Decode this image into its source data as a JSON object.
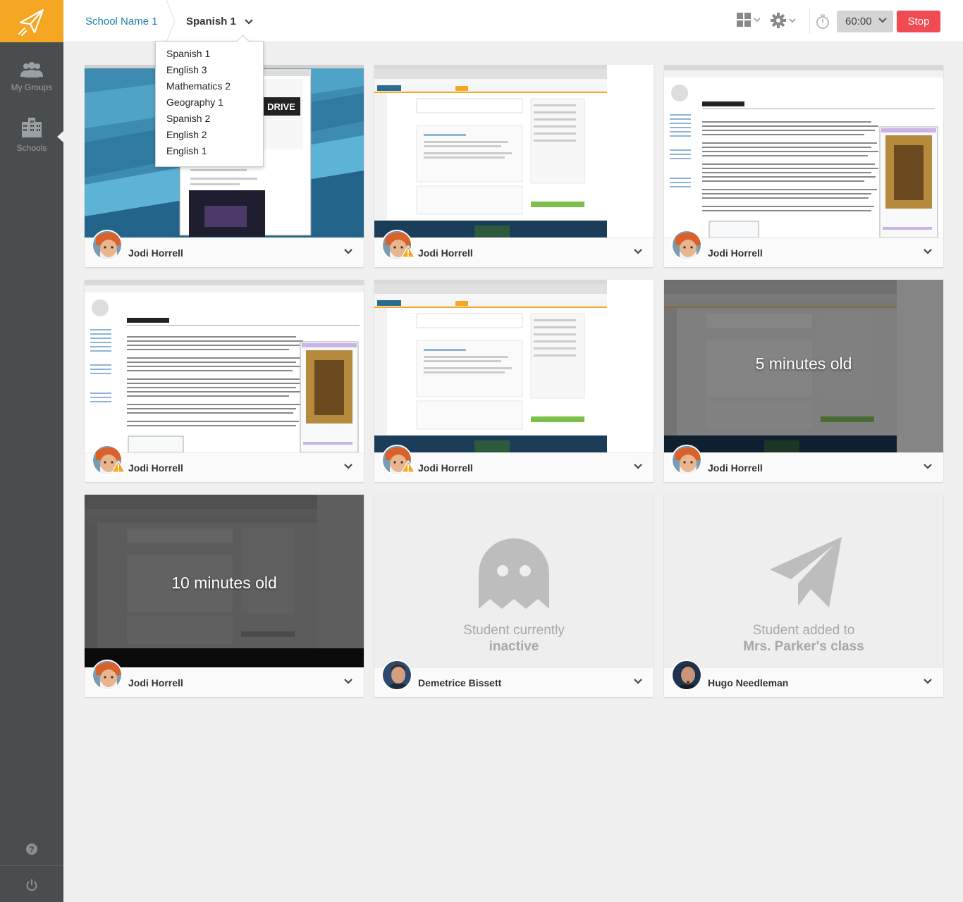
{
  "topbar": {
    "school": "School Name 1",
    "class_name": "Spanish 1",
    "timer": "60:00",
    "stop": "Stop"
  },
  "dropdown": {
    "items": [
      "Spanish 1",
      "English 3",
      "Mathematics 2",
      "Geography 1",
      "Spanish 2",
      "English 2",
      "English 1"
    ]
  },
  "sidebar": {
    "groups_label": "My Groups",
    "schools_label": "Schools"
  },
  "cards": [
    {
      "name": "Jodi Horrell",
      "screen": "desktop",
      "warning": false
    },
    {
      "name": "Jodi Horrell",
      "screen": "bigcampus",
      "warning": true
    },
    {
      "name": "Jodi Horrell",
      "screen": "wikipedia",
      "warning": false
    },
    {
      "name": "Jodi Horrell",
      "screen": "wikipedia",
      "warning": true
    },
    {
      "name": "Jodi Horrell",
      "screen": "bigcampus",
      "warning": true
    },
    {
      "name": "Jodi Horrell",
      "screen": "bigcampus-old",
      "age": "5 minutes old",
      "warning": false
    },
    {
      "name": "Jodi Horrell",
      "screen": "bigcampus-old",
      "age": "10 minutes old",
      "warning": false
    },
    {
      "name": "Demetrice Bissett",
      "screen": "inactive",
      "status_line1": "Student currently",
      "status_line2": "inactive"
    },
    {
      "name": "Hugo Needleman",
      "screen": "added",
      "status_line1": "Student added to",
      "status_line2": "Mrs. Parker's class"
    }
  ],
  "colors": {
    "brand": "#f5a623",
    "sidebar": "#4a4d50",
    "stop": "#f04b52",
    "link": "#1f7fa8"
  },
  "icons": [
    "logo-plane-icon",
    "groups-icon",
    "schools-icon",
    "help-icon",
    "power-icon",
    "grid-icon",
    "gear-icon",
    "timer-icon",
    "chevron-down-icon",
    "warning-icon",
    "ghost-icon",
    "paper-plane-icon"
  ]
}
